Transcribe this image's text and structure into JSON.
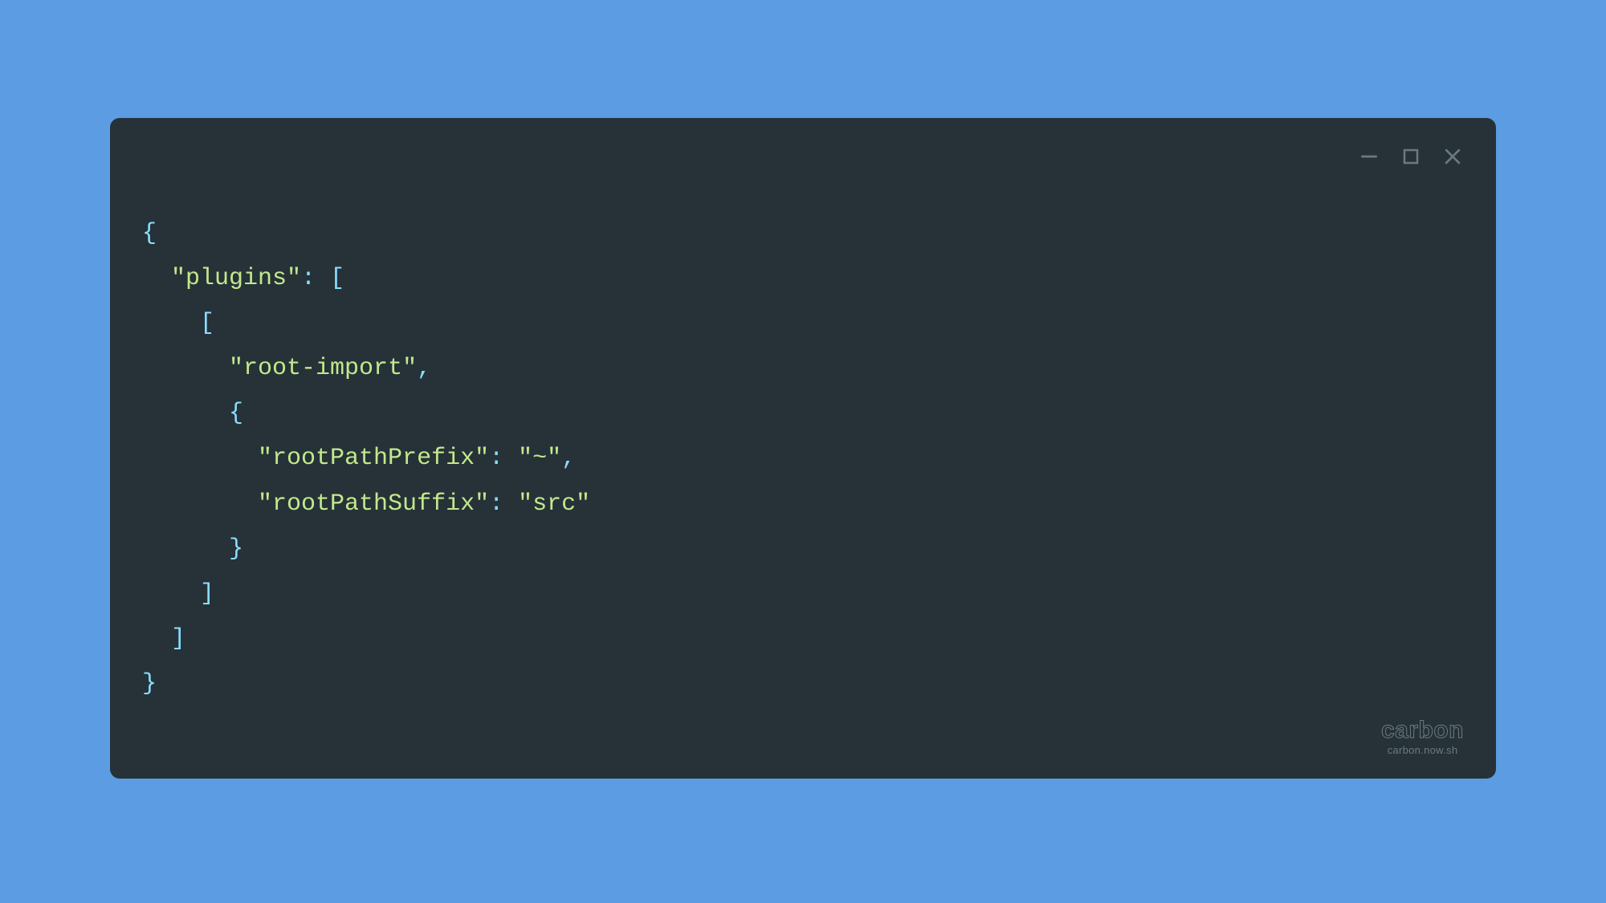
{
  "window": {
    "controls": {
      "minimize": "minimize",
      "maximize": "maximize",
      "close": "close"
    }
  },
  "code": {
    "lines": [
      {
        "indent": 0,
        "tokens": [
          {
            "t": "punct",
            "v": "{"
          }
        ]
      },
      {
        "indent": 1,
        "tokens": [
          {
            "t": "string",
            "v": "\"plugins\""
          },
          {
            "t": "punct",
            "v": ":"
          },
          {
            "t": "plain",
            "v": " "
          },
          {
            "t": "punct",
            "v": "["
          }
        ]
      },
      {
        "indent": 2,
        "tokens": [
          {
            "t": "punct",
            "v": "["
          }
        ]
      },
      {
        "indent": 3,
        "tokens": [
          {
            "t": "string",
            "v": "\"root-import\""
          },
          {
            "t": "comma",
            "v": ","
          }
        ]
      },
      {
        "indent": 3,
        "tokens": [
          {
            "t": "punct",
            "v": "{"
          }
        ]
      },
      {
        "indent": 4,
        "tokens": [
          {
            "t": "string",
            "v": "\"rootPathPrefix\""
          },
          {
            "t": "punct",
            "v": ":"
          },
          {
            "t": "plain",
            "v": " "
          },
          {
            "t": "string",
            "v": "\"~\""
          },
          {
            "t": "comma",
            "v": ","
          }
        ]
      },
      {
        "indent": 4,
        "tokens": [
          {
            "t": "string",
            "v": "\"rootPathSuffix\""
          },
          {
            "t": "punct",
            "v": ":"
          },
          {
            "t": "plain",
            "v": " "
          },
          {
            "t": "string",
            "v": "\"src\""
          }
        ]
      },
      {
        "indent": 3,
        "tokens": [
          {
            "t": "punct",
            "v": "}"
          }
        ]
      },
      {
        "indent": 2,
        "tokens": [
          {
            "t": "punct",
            "v": "]"
          }
        ]
      },
      {
        "indent": 1,
        "tokens": [
          {
            "t": "punct",
            "v": "]"
          }
        ]
      },
      {
        "indent": 0,
        "tokens": [
          {
            "t": "punct",
            "v": "}"
          }
        ]
      }
    ]
  },
  "watermark": {
    "logo": "carbon",
    "url": "carbon.now.sh"
  }
}
